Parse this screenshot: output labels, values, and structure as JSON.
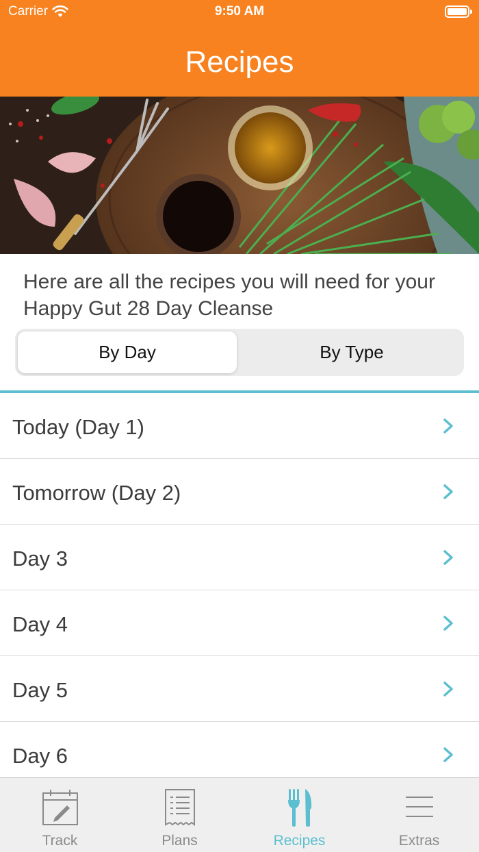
{
  "status": {
    "carrier": "Carrier",
    "time": "9:50 AM"
  },
  "nav": {
    "title": "Recipes"
  },
  "intro": {
    "text": "Here are all the recipes you will need for your Happy Gut 28 Day Cleanse"
  },
  "segments": {
    "left": "By Day",
    "right": "By Type",
    "selected": "By Day"
  },
  "days": [
    {
      "label": "Today (Day 1)"
    },
    {
      "label": "Tomorrow (Day 2)"
    },
    {
      "label": "Day 3"
    },
    {
      "label": "Day 4"
    },
    {
      "label": "Day 5"
    },
    {
      "label": "Day 6"
    }
  ],
  "tabs": [
    {
      "label": "Track",
      "icon": "calendar-edit-icon"
    },
    {
      "label": "Plans",
      "icon": "receipt-list-icon"
    },
    {
      "label": "Recipes",
      "icon": "fork-knife-icon",
      "active": true
    },
    {
      "label": "Extras",
      "icon": "menu-lines-icon"
    }
  ],
  "colors": {
    "brand": "#f7821f",
    "accent": "#5bbfcf"
  }
}
